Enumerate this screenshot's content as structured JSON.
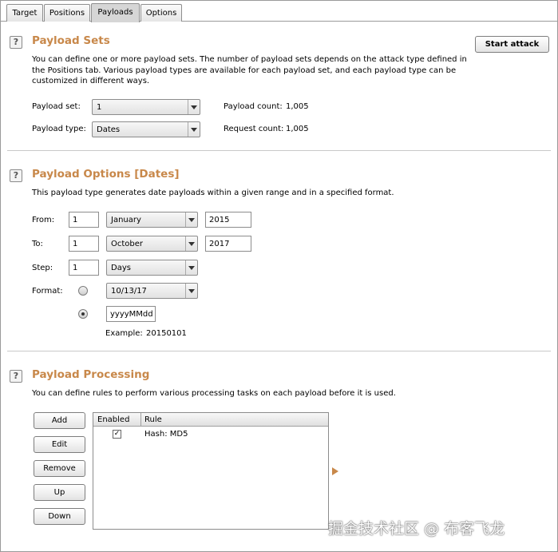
{
  "tabs": [
    {
      "label": "Target"
    },
    {
      "label": "Positions"
    },
    {
      "label": "Payloads"
    },
    {
      "label": "Options"
    }
  ],
  "payload_sets": {
    "title": "Payload Sets",
    "description": "You can define one or more payload sets. The number of payload sets depends on the attack type defined in the Positions tab. Various payload types are available for each payload set, and each payload type can be customized in different ways.",
    "start_attack_label": "Start attack",
    "payload_set_label": "Payload set:",
    "payload_set_value": "1",
    "payload_type_label": "Payload type:",
    "payload_type_value": "Dates",
    "payload_count_label": "Payload count:",
    "payload_count_value": "1,005",
    "request_count_label": "Request count:",
    "request_count_value": "1,005"
  },
  "payload_options": {
    "title": "Payload Options [Dates]",
    "description": "This payload type generates date payloads within a given range and in a specified format.",
    "from_label": "From:",
    "from_day": "1",
    "from_month": "January",
    "from_year": "2015",
    "to_label": "To:",
    "to_day": "1",
    "to_month": "October",
    "to_year": "2017",
    "step_label": "Step:",
    "step_value": "1",
    "step_unit": "Days",
    "format_label": "Format:",
    "format_preset": "10/13/17",
    "format_preset_selected": false,
    "format_custom": "yyyyMMdd",
    "format_custom_selected": true,
    "example_label": "Example:",
    "example_value": "20150101"
  },
  "payload_processing": {
    "title": "Payload Processing",
    "description": "You can define rules to perform various processing tasks on each payload before it is used.",
    "buttons": {
      "add": "Add",
      "edit": "Edit",
      "remove": "Remove",
      "up": "Up",
      "down": "Down"
    },
    "columns": {
      "enabled": "Enabled",
      "rule": "Rule"
    },
    "rows": [
      {
        "enabled": true,
        "check_glyph": "✓",
        "rule": "Hash: MD5"
      }
    ]
  },
  "help_icon_glyph": "?",
  "watermark": "掘金技术社区 @ 布客飞龙",
  "colors": {
    "section_title": "#c8884a",
    "border": "#8c8c8c",
    "background": "#ffffff"
  },
  "icons": [
    "help-icon",
    "dropdown-arrow-icon",
    "play-arrow-icon",
    "checkbox-checked-icon"
  ]
}
